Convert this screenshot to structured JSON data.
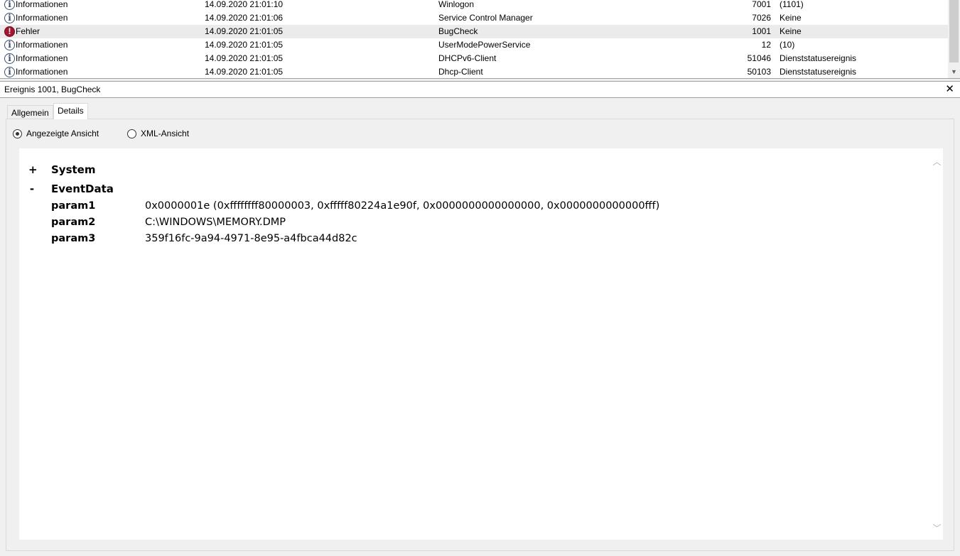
{
  "event_list": {
    "rows": [
      {
        "level": "Informationen",
        "level_icon": "info-icon",
        "date": "14.09.2020 21:01:10",
        "source": "Winlogon",
        "event_id": "7001",
        "task": "(1101)"
      },
      {
        "level": "Informationen",
        "level_icon": "info-icon",
        "date": "14.09.2020 21:01:06",
        "source": "Service Control Manager",
        "event_id": "7026",
        "task": "Keine"
      },
      {
        "level": "Fehler",
        "level_icon": "error-icon",
        "date": "14.09.2020 21:01:05",
        "source": "BugCheck",
        "event_id": "1001",
        "task": "Keine"
      },
      {
        "level": "Informationen",
        "level_icon": "info-icon",
        "date": "14.09.2020 21:01:05",
        "source": "UserModePowerService",
        "event_id": "12",
        "task": "(10)"
      },
      {
        "level": "Informationen",
        "level_icon": "info-icon",
        "date": "14.09.2020 21:01:05",
        "source": "DHCPv6-Client",
        "event_id": "51046",
        "task": "Dienststatusereignis"
      },
      {
        "level": "Informationen",
        "level_icon": "info-icon",
        "date": "14.09.2020 21:01:05",
        "source": "Dhcp-Client",
        "event_id": "50103",
        "task": "Dienststatusereignis"
      }
    ],
    "selected_index": 2
  },
  "detail": {
    "title": "Ereignis 1001, BugCheck",
    "close_symbol": "✕",
    "tabs": [
      {
        "label": "Allgemein"
      },
      {
        "label": "Details"
      }
    ],
    "active_tab": "Details",
    "views": {
      "friendly_label": "Angezeigte Ansicht",
      "xml_label": "XML-Ansicht",
      "selected": "Angezeigte Ansicht"
    },
    "tree": {
      "system": {
        "toggle": "+",
        "label": "System"
      },
      "eventdata": {
        "toggle": "-",
        "label": "EventData",
        "params": [
          {
            "name": "param1",
            "value": "0x0000001e (0xffffffff80000003, 0xfffff80224a1e90f, 0x0000000000000000, 0x0000000000000fff)"
          },
          {
            "name": "param2",
            "value": "C:\\WINDOWS\\MEMORY.DMP"
          },
          {
            "name": "param3",
            "value": "359f16fc-9a94-4971-8e95-a4fbca44d82c"
          }
        ]
      }
    }
  },
  "colors": {
    "selected_row": "#ebebeb",
    "error_icon": "#a31633",
    "info_icon": "#3b4d6b",
    "panel_bg": "#f0f0f0"
  }
}
